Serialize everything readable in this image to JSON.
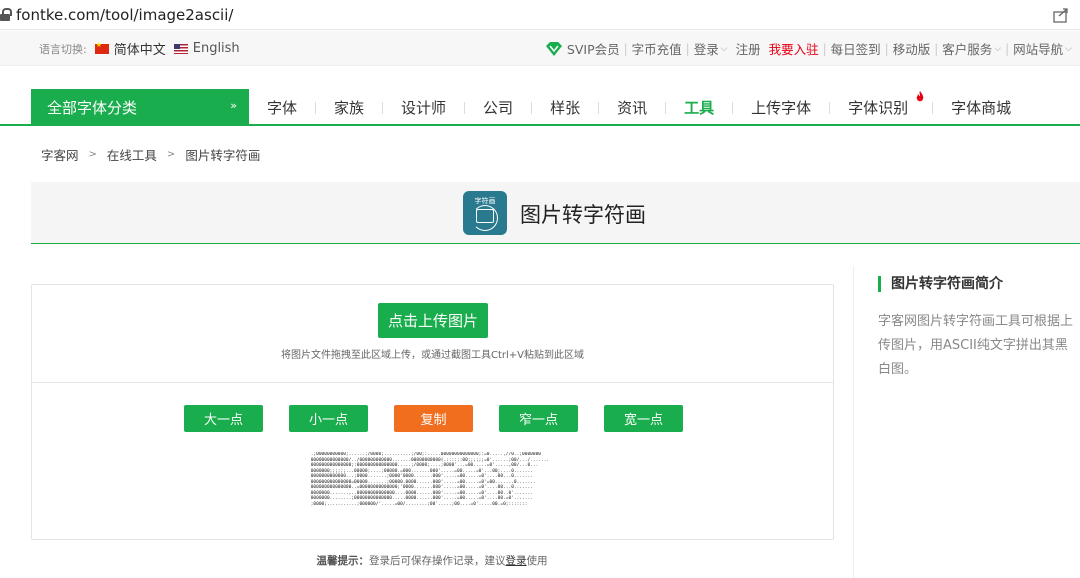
{
  "browser": {
    "url": "fontke.com/tool/image2ascii/"
  },
  "topbar": {
    "lang_label": "语言切换:",
    "lang_cn": "简体中文",
    "lang_en": "English",
    "links": [
      "SVIP会员",
      "字币充值",
      "登录",
      "注册",
      "我要入驻",
      "每日签到",
      "移动版",
      "客户服务",
      "网站导航"
    ]
  },
  "nav": {
    "category_button": "全部字体分类",
    "items": [
      "字体",
      "家族",
      "设计师",
      "公司",
      "样张",
      "资讯",
      "工具",
      "上传字体",
      "字体识别",
      "字体商城"
    ],
    "active_index": 6
  },
  "breadcrumb": [
    "字客网",
    "在线工具",
    "图片转字符画"
  ],
  "tool": {
    "icon_label": "字符画",
    "title": "图片转字符画",
    "upload_button": "点击上传图片",
    "upload_hint": "将图片文件拖拽至此区域上传，或通过截图工具Ctrl+V粘贴到此区域",
    "buttons": [
      "大一点",
      "小一点",
      "复制",
      "窄一点",
      "宽一点"
    ],
    "ascii_art": " .;00000000000;......;/0000;..........;/00;:.....00000000000000;:=0.....,//0..;0000000\n 00000000000000/../000000000000.......00000000000(.::::::00;;;;;;=0'......;00/.../.......\n 000000000000000;:000000000000000.....;/0000;....;0000'...=00.....=0'.....,00/...0...\n 0000000;;;;;;...00000;....;00000.=000.......000'.....=00.....=0'...00;....0.......\n 0000000000000...;0000.......;0000'0000.......000'.....=00.....=0'....00...0.......\n 000000000000000=00000.......;00000.0000......000'.....=00.....=0'=00.......0.......\n 000000000000000..=00000000000000;'0000.......000'.....=00.....=0'....00...0.......\n 0000000.......,..00000000000000....0000......000'.....=00.....=0'....00..0'.......\n 0000000........;00000000000000.....0000......000'.....=00.....=0'....00.=0'.......\n ;0000;...........;000000/'.....=00/........;00'.....;00....=0'.....00.=0;:::::::",
    "tip_label": "温馨提示：",
    "tip_text": "登录后可保存操作记录，建议",
    "tip_link": "登录",
    "tip_tail": "使用"
  },
  "sidebar": {
    "title": "图片转字符画简介",
    "text": "字客网图片转字符画工具可根据上传图片，用ASCII纯文字拼出其黑白图。"
  },
  "colors": {
    "accent": "#1aad4e",
    "orange": "#f06e1e",
    "hot": "#e60012"
  }
}
